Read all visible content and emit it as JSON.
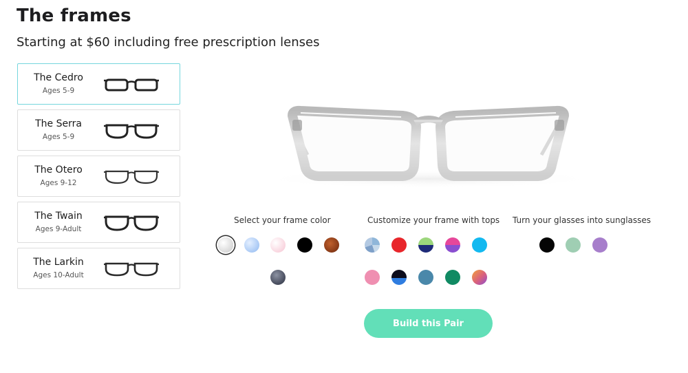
{
  "header": {
    "title": "The frames",
    "subtitle": "Starting at $60 including free prescription lenses"
  },
  "frames": [
    {
      "name": "The Cedro",
      "ages": "Ages 5-9",
      "selected": true
    },
    {
      "name": "The Serra",
      "ages": "Ages 5-9",
      "selected": false
    },
    {
      "name": "The Otero",
      "ages": "Ages 9-12",
      "selected": false
    },
    {
      "name": "The Twain",
      "ages": "Ages 9-Adult",
      "selected": false
    },
    {
      "name": "The Larkin",
      "ages": "Ages 10-Adult",
      "selected": false
    }
  ],
  "sections": {
    "frame_color": {
      "label": "Select your frame color",
      "swatches": [
        "clear",
        "light-blue",
        "light-pink",
        "black",
        "tortoise",
        "slate"
      ],
      "selected": "clear"
    },
    "tops": {
      "label": "Customize your frame with tops",
      "swatches": [
        "blue-camo",
        "red",
        "green-navy",
        "pink-purple",
        "sky-blue",
        "pink",
        "black-blue",
        "steel-blue",
        "emerald",
        "sunset"
      ]
    },
    "sunglasses": {
      "label": "Turn your glasses into sunglasses",
      "swatches": [
        "black",
        "mint",
        "lavender"
      ]
    }
  },
  "colors": {
    "accent": "#62dfb8",
    "selected_border": "#75d6dd"
  },
  "cta": {
    "label": "Build this Pair"
  }
}
